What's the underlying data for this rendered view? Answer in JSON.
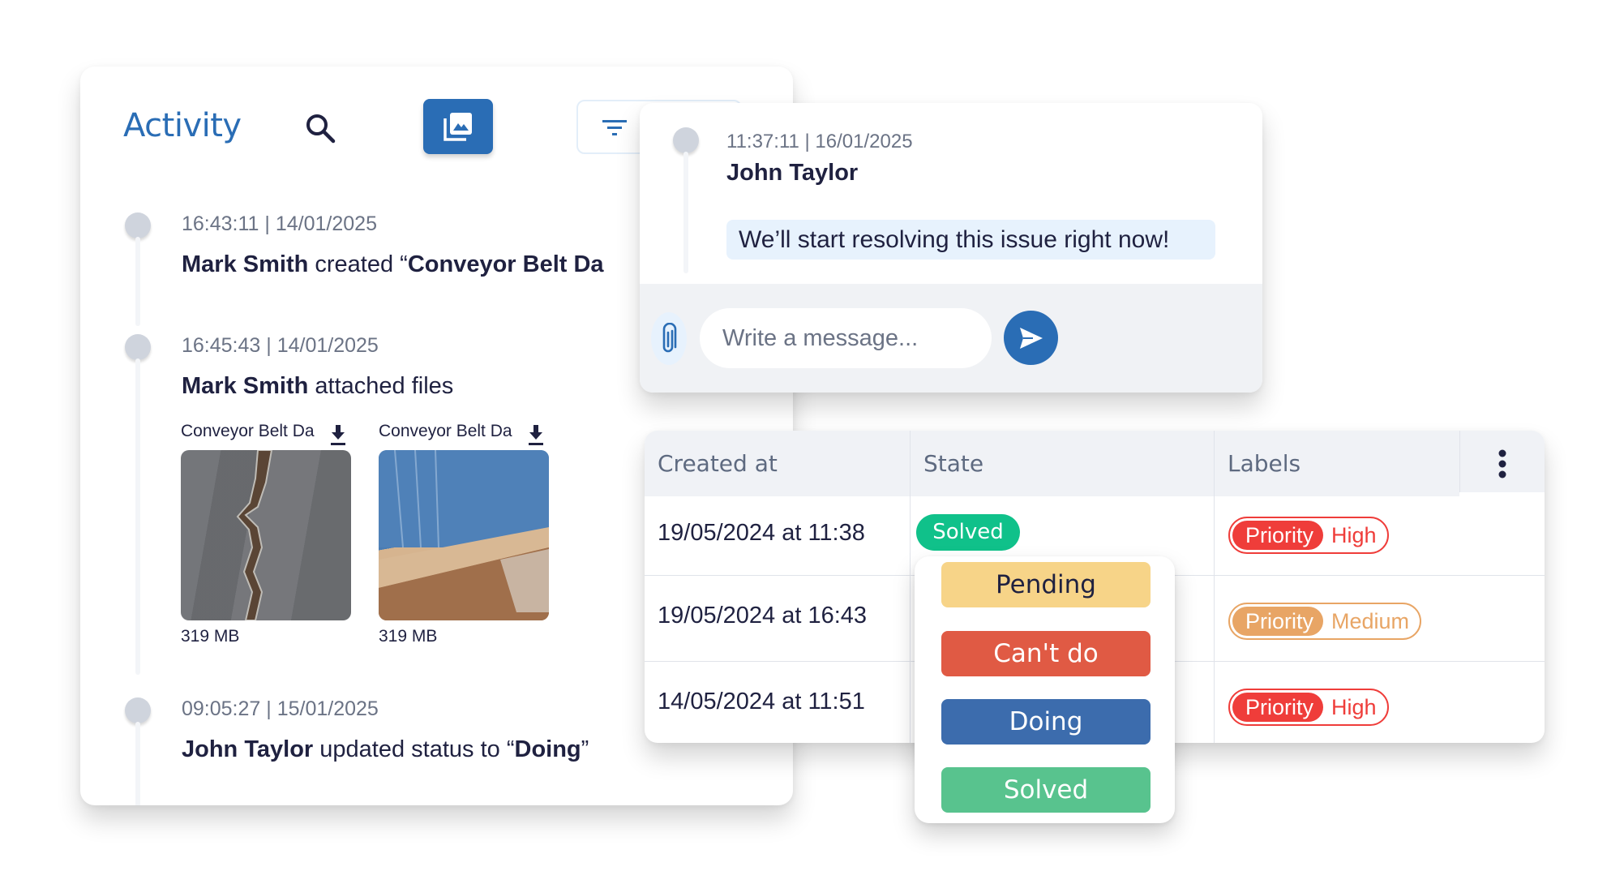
{
  "activity": {
    "title": "Activity",
    "icons": {
      "search": "search-icon",
      "gallery": "gallery-icon",
      "filter": "filter-icon"
    },
    "items": [
      {
        "time": "16:43:11 | 14/01/2025",
        "author": "Mark Smith",
        "action": " created “",
        "object": "Conveyor Belt Da"
      },
      {
        "time": "16:45:43 | 14/01/2025",
        "author": "Mark Smith",
        "action": " attached files",
        "files": [
          {
            "name": "Conveyor Belt Da",
            "size": "319 MB",
            "icon": "download-icon"
          },
          {
            "name": "Conveyor Belt Da",
            "size": "319 MB",
            "icon": "download-icon"
          }
        ]
      },
      {
        "time": "09:05:27 | 15/01/2025",
        "author": "John Taylor",
        "action": " updated status to  “",
        "object": "Doing",
        "suffix": "”"
      }
    ]
  },
  "chat": {
    "time": "11:37:11 | 16/01/2025",
    "author": "John Taylor",
    "message": "We’ll start resolving this issue right now!",
    "input_placeholder": "Write a message...",
    "input_value": "",
    "icons": {
      "attach": "paperclip-icon",
      "send": "send-icon"
    }
  },
  "table": {
    "columns": [
      "Created at",
      "State",
      "Labels"
    ],
    "menu_icon": "kebab-menu-icon",
    "rows": [
      {
        "created_at": "19/05/2024 at 11:38",
        "state": "Solved",
        "label_key": "Priority",
        "label_value": "High"
      },
      {
        "created_at": "19/05/2024 at 16:43",
        "state": "",
        "label_key": "Priority",
        "label_value": "Medium"
      },
      {
        "created_at": "14/05/2024 at 11:51",
        "state": "",
        "label_key": "Priority",
        "label_value": "High"
      }
    ]
  },
  "state_dropdown": {
    "options": [
      {
        "label": "Pending",
        "bg": "#f7d488",
        "fg": "#1f2140"
      },
      {
        "label": "Can't do",
        "bg": "#e05a44",
        "fg": "#ffffff"
      },
      {
        "label": "Doing",
        "bg": "#3c6cad",
        "fg": "#ffffff"
      },
      {
        "label": "Solved",
        "bg": "#58c38e",
        "fg": "#ffffff"
      }
    ]
  },
  "colors": {
    "brand": "#2a6db5",
    "solved_badge": "#10c18a",
    "priority_high": "#ef3d3a",
    "priority_medium": "#e8a565",
    "timeline_dot": "#cfd4dd",
    "text_dark": "#1f2140",
    "text_muted": "#6b7385"
  }
}
